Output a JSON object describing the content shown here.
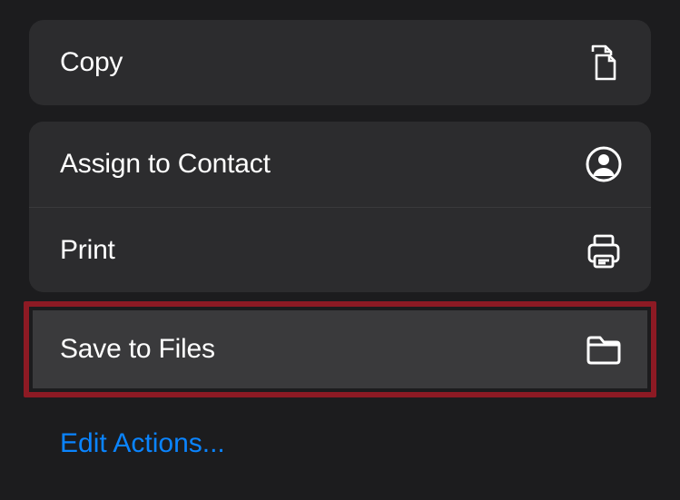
{
  "actions": {
    "copy": {
      "label": "Copy",
      "icon": "copy-icon"
    },
    "assign_contact": {
      "label": "Assign to Contact",
      "icon": "contact-icon"
    },
    "print": {
      "label": "Print",
      "icon": "print-icon"
    },
    "save_files": {
      "label": "Save to Files",
      "icon": "folder-icon"
    }
  },
  "footer": {
    "edit_link": "Edit Actions..."
  },
  "highlight": "save_files"
}
